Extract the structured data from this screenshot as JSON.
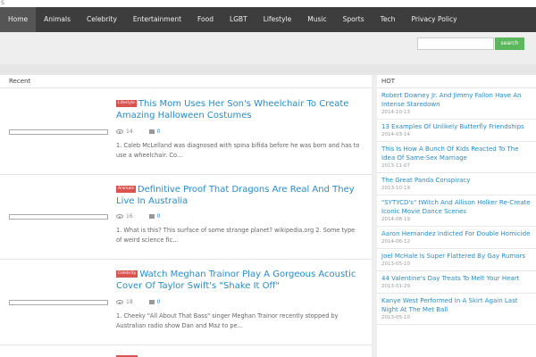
{
  "top_strip": "S",
  "nav": [
    "Home",
    "Animals",
    "Celebrity",
    "Entertainment",
    "Food",
    "LGBT",
    "Lifestyle",
    "Music",
    "Sports",
    "Tech",
    "Privacy Policy"
  ],
  "search": {
    "placeholder": "",
    "button": "search"
  },
  "recent": {
    "heading": "Recent",
    "articles": [
      {
        "tag": "Lifestyle",
        "title": "This Mom Uses Her Son's Wheelchair To Create Amazing Halloween Costumes",
        "views": "14",
        "comments": "0",
        "excerpt": "1. Caleb McLelland was diagnosed with spina bifida before he was born and has to use a wheelchair. Co..."
      },
      {
        "tag": "Animals",
        "title": "Definitive Proof That Dragons Are Real And They Live In Australia",
        "views": "16",
        "comments": "0",
        "excerpt": "1. What is this? This surface of some strange planet? wikipedia.org 2. Some type of weird science fic..."
      },
      {
        "tag": "Celebrity",
        "title": "Watch Meghan Trainor Play A Gorgeous Acoustic Cover Of Taylor Swift's \"Shake It Off\"",
        "views": "18",
        "comments": "0",
        "excerpt": "1. Cheeky \"All About That Bass\" singer Meghan Trainor recently stopped by Australian radio show Dan and Maz to pe..."
      }
    ]
  },
  "hot": {
    "heading": "HOT",
    "items": [
      {
        "title": "Robert Downey Jr. And Jimmy Fallon Have An Intense Staredown",
        "date": "2014-10-13"
      },
      {
        "title": "13 Examples Of Unlikely Butterfly Friendships",
        "date": "2014-03-14"
      },
      {
        "title": "This Is How A Bunch Of Kids Reacted To The Idea Of Same-Sex Marriage",
        "date": "2013-11-07"
      },
      {
        "title": "The Great Panda Conspiracy",
        "date": "2013-10-19"
      },
      {
        "title": "\"SYTYCD's\" tWitch And Allison Holker Re-Create Iconic Movie Dance Scenes",
        "date": "2014-08-19"
      },
      {
        "title": "Aaron Hernandez Indicted For Double Homicide",
        "date": "2014-06-12"
      },
      {
        "title": "Joel McHale Is Super Flattered By Gay Rumors",
        "date": "2013-05-10"
      },
      {
        "title": "44 Valentine's Day Treats To Melt Your Heart",
        "date": "2013-01-29"
      },
      {
        "title": "Kanye West Performed In A Skirt Again Last Night At The Met Ball",
        "date": "2013-05-10"
      }
    ]
  },
  "colors": {
    "nav_bg": "#3d3d3d",
    "link": "#2b8bc6",
    "tag": "#d9534f",
    "search_btn": "#5cb85c"
  }
}
